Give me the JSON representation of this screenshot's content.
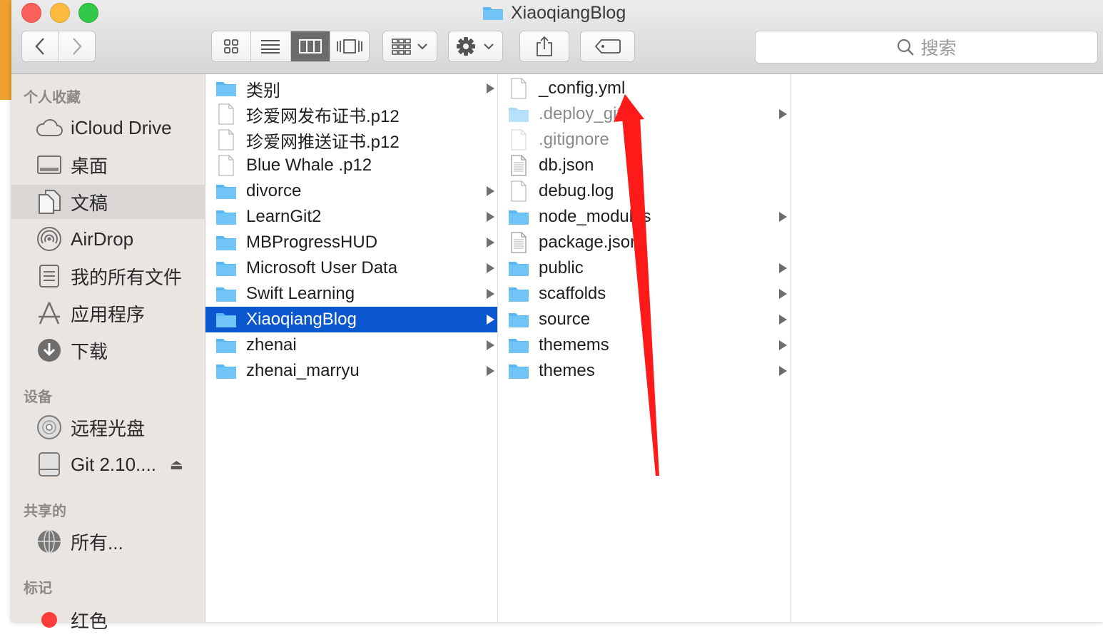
{
  "window": {
    "title": "XiaoqiangBlog"
  },
  "toolbar": {
    "back_icon": "chevron-left-icon",
    "forward_icon": "chevron-right-icon",
    "view_modes": [
      "icon-view",
      "list-view",
      "column-view",
      "cover-flow-view"
    ],
    "active_view": "column-view",
    "search_placeholder": "搜索"
  },
  "sidebar": {
    "favorites_header": "个人收藏",
    "favorites": [
      {
        "label": "iCloud Drive",
        "icon": "cloud-icon"
      },
      {
        "label": "桌面",
        "icon": "desktop-icon"
      },
      {
        "label": "文稿",
        "icon": "documents-icon",
        "selected": true
      },
      {
        "label": "AirDrop",
        "icon": "airdrop-icon"
      },
      {
        "label": "我的所有文件",
        "icon": "all-files-icon"
      },
      {
        "label": "应用程序",
        "icon": "applications-icon"
      },
      {
        "label": "下载",
        "icon": "downloads-icon"
      }
    ],
    "devices_header": "设备",
    "devices": [
      {
        "label": "远程光盘",
        "icon": "disc-icon"
      },
      {
        "label": "Git 2.10....",
        "icon": "drive-icon",
        "eject": "⏏"
      }
    ],
    "shared_header": "共享的",
    "shared": [
      {
        "label": "所有...",
        "icon": "network-icon"
      }
    ],
    "tags_header": "标记",
    "tags": [
      {
        "label": "红色",
        "color": "#fc3d39"
      }
    ]
  },
  "column1": [
    {
      "label": "类别",
      "type": "folder",
      "arrow": true
    },
    {
      "label": "珍爱网发布证书.p12",
      "type": "file"
    },
    {
      "label": "珍爱网推送证书.p12",
      "type": "file"
    },
    {
      "label": "Blue Whale .p12",
      "type": "file"
    },
    {
      "label": "divorce",
      "type": "folder",
      "arrow": true
    },
    {
      "label": "LearnGit2",
      "type": "folder",
      "arrow": true
    },
    {
      "label": "MBProgressHUD",
      "type": "folder",
      "arrow": true
    },
    {
      "label": "Microsoft User Data",
      "type": "folder",
      "arrow": true
    },
    {
      "label": "Swift Learning",
      "type": "folder",
      "arrow": true
    },
    {
      "label": "XiaoqiangBlog",
      "type": "folder",
      "arrow": true,
      "selected": true
    },
    {
      "label": "zhenai",
      "type": "folder",
      "arrow": true
    },
    {
      "label": "zhenai_marryu",
      "type": "folder",
      "arrow": true
    }
  ],
  "column2": [
    {
      "label": "_config.yml",
      "type": "file"
    },
    {
      "label": ".deploy_git",
      "type": "folder",
      "arrow": true,
      "dim": true
    },
    {
      "label": ".gitignore",
      "type": "file",
      "dim": true
    },
    {
      "label": "db.json",
      "type": "doc"
    },
    {
      "label": "debug.log",
      "type": "file"
    },
    {
      "label": "node_modules",
      "type": "folder",
      "arrow": true
    },
    {
      "label": "package.json",
      "type": "doc"
    },
    {
      "label": "public",
      "type": "folder",
      "arrow": true
    },
    {
      "label": "scaffolds",
      "type": "folder",
      "arrow": true
    },
    {
      "label": "source",
      "type": "folder",
      "arrow": true
    },
    {
      "label": "themems",
      "type": "folder",
      "arrow": true
    },
    {
      "label": "themes",
      "type": "folder",
      "arrow": true
    }
  ],
  "annotation": {
    "color": "#ff1a1a"
  },
  "colors": {
    "folder": "#5ab7f2",
    "selection": "#0b57d0"
  }
}
